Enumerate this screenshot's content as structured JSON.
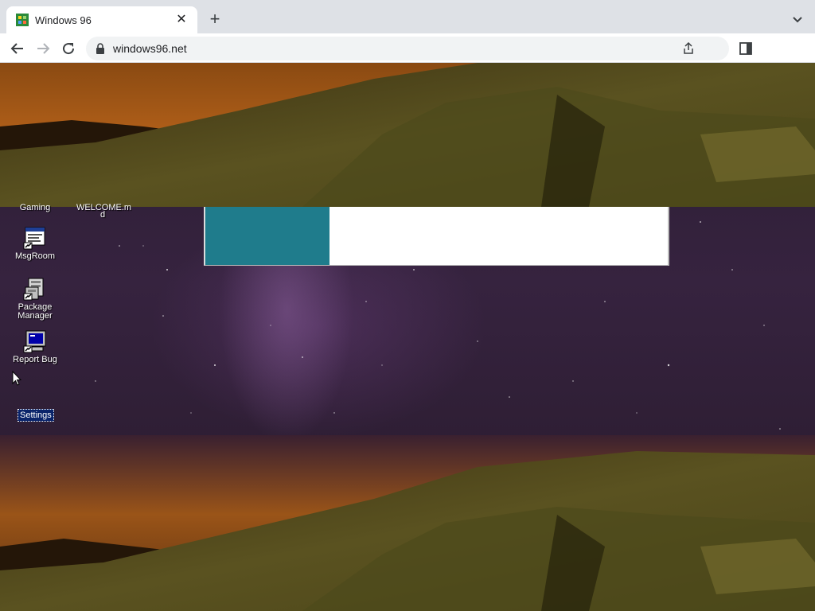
{
  "browser": {
    "tab": {
      "title": "Windows 96",
      "close_icon": "close-icon"
    },
    "newtab_icon": "plus-icon",
    "url": "windows96.net"
  },
  "desktop": {
    "icons": [
      {
        "label": "MsgRoom",
        "icon": "msgroom-icon"
      },
      {
        "label": "Package Manager",
        "icon": "package-manager-icon"
      },
      {
        "label": "Report Bug",
        "icon": "report-bug-icon"
      }
    ],
    "clipped_labels": {
      "gaming": "Gaming",
      "welcome_line1": "WELCOME.m",
      "welcome_line2": "d"
    },
    "selected_label": "Settings"
  },
  "colors": {
    "window_panel": "#1f7c8c",
    "selection": "#0a246a"
  }
}
